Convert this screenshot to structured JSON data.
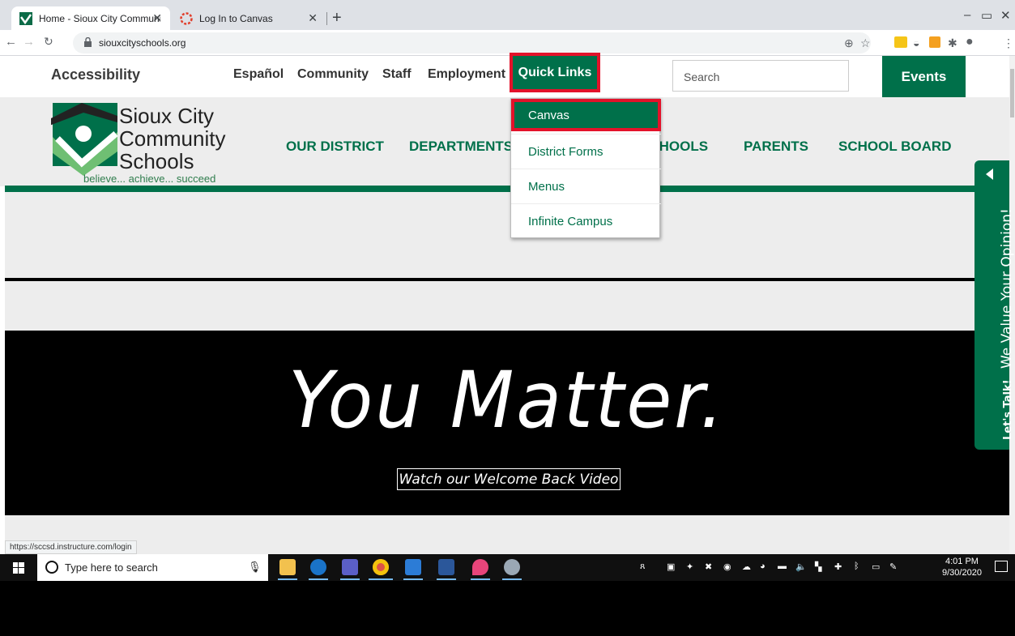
{
  "browser": {
    "tabs": [
      {
        "title": "Home - Sioux City Community Sc",
        "icon": "sioux-city-favicon",
        "active": true
      },
      {
        "title": "Log In to Canvas",
        "icon": "canvas-favicon",
        "active": false
      }
    ],
    "url": "siouxcityschools.org",
    "status_url": "https://sccsd.instructure.com/login"
  },
  "topnav": {
    "accessibility": "Accessibility",
    "links": [
      "Español",
      "Community",
      "Staff",
      "Employment"
    ],
    "quick_links": "Quick Links",
    "search_placeholder": "Search",
    "events": "Events"
  },
  "logo": {
    "line1": "Sioux City",
    "line2": "Community",
    "line3": "Schools",
    "tagline": "believe... achieve... succeed"
  },
  "mainnav": {
    "items": [
      "OUR DISTRICT",
      "DEPARTMENTS",
      "SCHOOLS",
      "PARENTS",
      "SCHOOL BOARD"
    ]
  },
  "quick_links_menu": {
    "items": [
      "Canvas",
      "District Forms",
      "Menus",
      "Infinite Campus"
    ]
  },
  "hero": {
    "title": "You Matter.",
    "button": "Watch our Welcome Back Video"
  },
  "feedback": {
    "talk": "Let's Talk!",
    "text": "We Value Your Opinion!"
  },
  "taskbar": {
    "search_placeholder": "Type here to search",
    "time": "4:01 PM",
    "date": "9/30/2020"
  },
  "colors": {
    "brand_green": "#00704a",
    "highlight_red": "#e3122a"
  }
}
